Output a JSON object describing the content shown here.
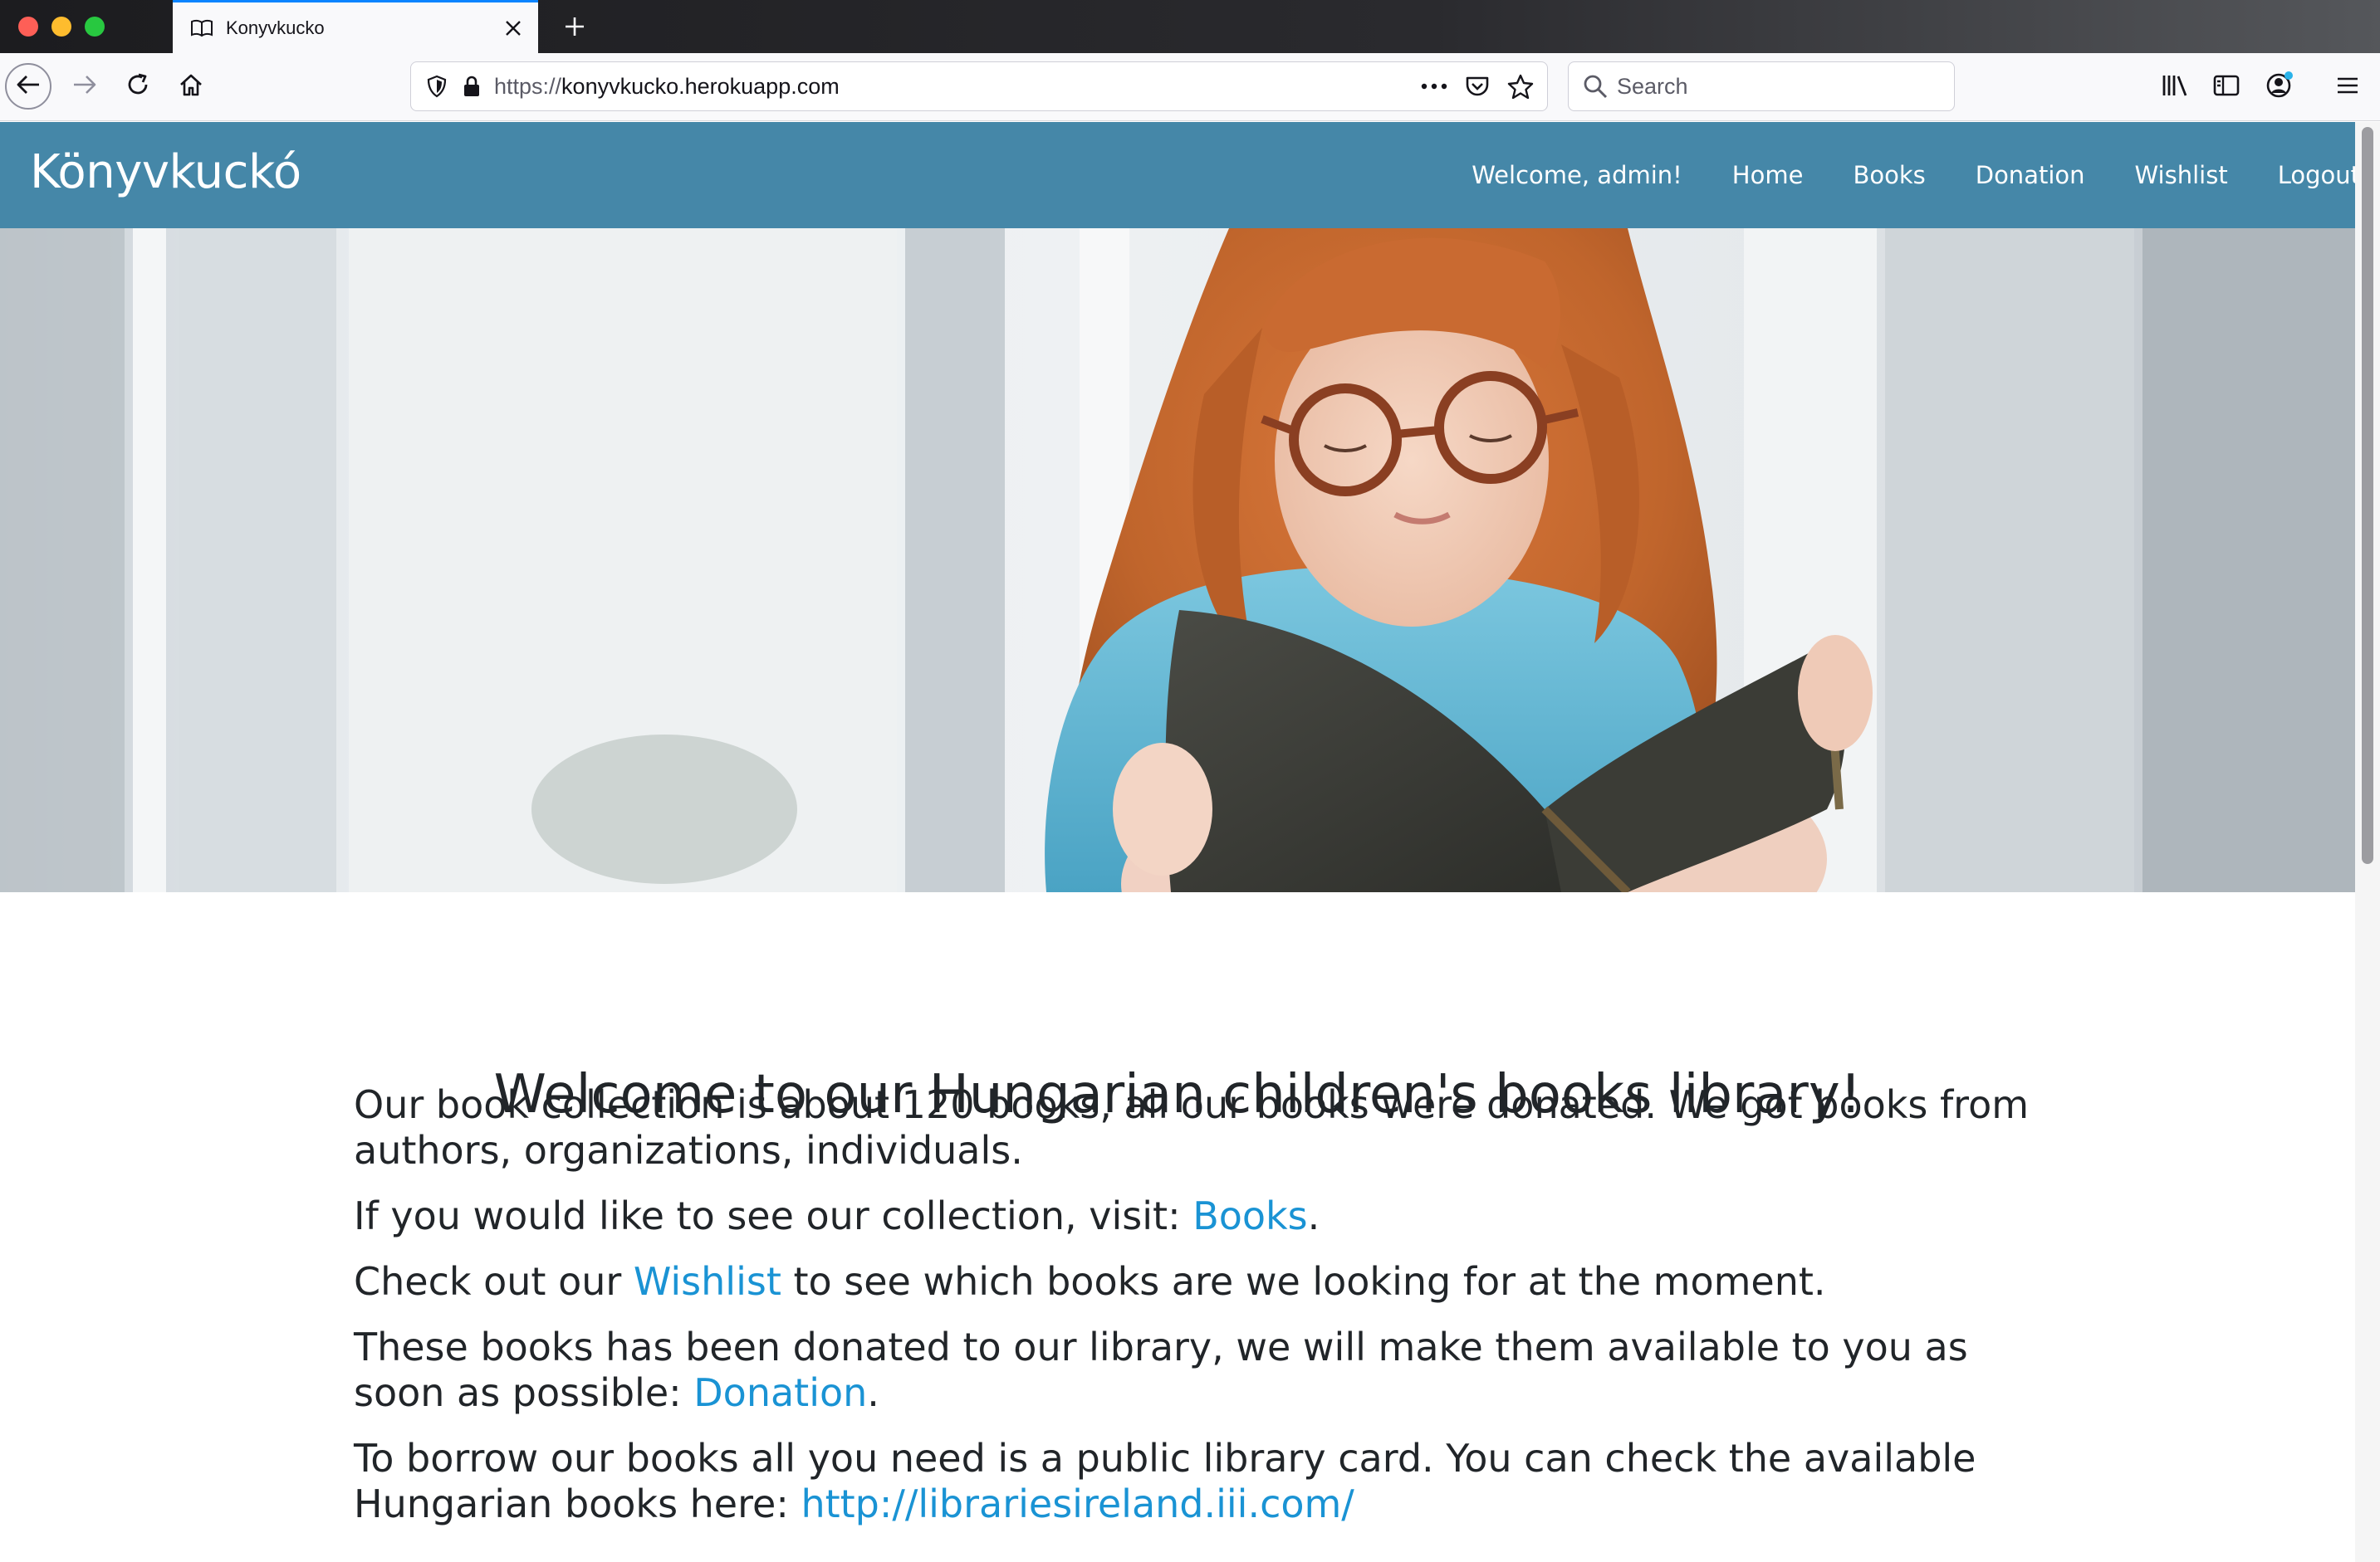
{
  "browser": {
    "tab_title": "Konyvkucko",
    "url_prefix": "https://",
    "url_host": "konyvkucko.herokuapp.com",
    "search_placeholder": "Search"
  },
  "site": {
    "brand": "Könyvkuckó",
    "nav": {
      "welcome": "Welcome, admin!",
      "home": "Home",
      "books": "Books",
      "donation": "Donation",
      "wishlist": "Wishlist",
      "logout": "Logout"
    },
    "accent_color": "#4587a8",
    "link_color": "#1a93d4"
  },
  "main": {
    "title": "Welcome to our Hungarian children's books library!",
    "p1": "Our book collection is about 120 books, all our books were donated. We got books from authors, organizations, individuals.",
    "p2_before": "If you would like to see our collection, visit: ",
    "p2_link": "Books",
    "p2_after": ".",
    "p3_before": "Check out our ",
    "p3_link": "Wishlist",
    "p3_after": " to see which books are we looking for at the moment.",
    "p4_before": "These books has been donated to our library, we will make them available to you as soon as possible: ",
    "p4_link": "Donation",
    "p4_after": ".",
    "p5_before": "To borrow our books all you need is a public library card. You can check the available Hungarian books here: ",
    "p5_link": "http://librariesireland.iii.com/"
  },
  "icons": {
    "tab": "book-icon",
    "back": "arrow-left-icon",
    "forward": "arrow-right-icon",
    "reload": "reload-icon",
    "home": "home-icon",
    "shield": "shield-icon",
    "lock": "lock-icon",
    "more": "ellipsis-icon",
    "pocket": "pocket-icon",
    "bookmark": "star-icon",
    "search": "search-icon",
    "library": "library-icon",
    "sidebar": "sidebar-icon",
    "account": "account-icon",
    "menu": "hamburger-icon"
  }
}
